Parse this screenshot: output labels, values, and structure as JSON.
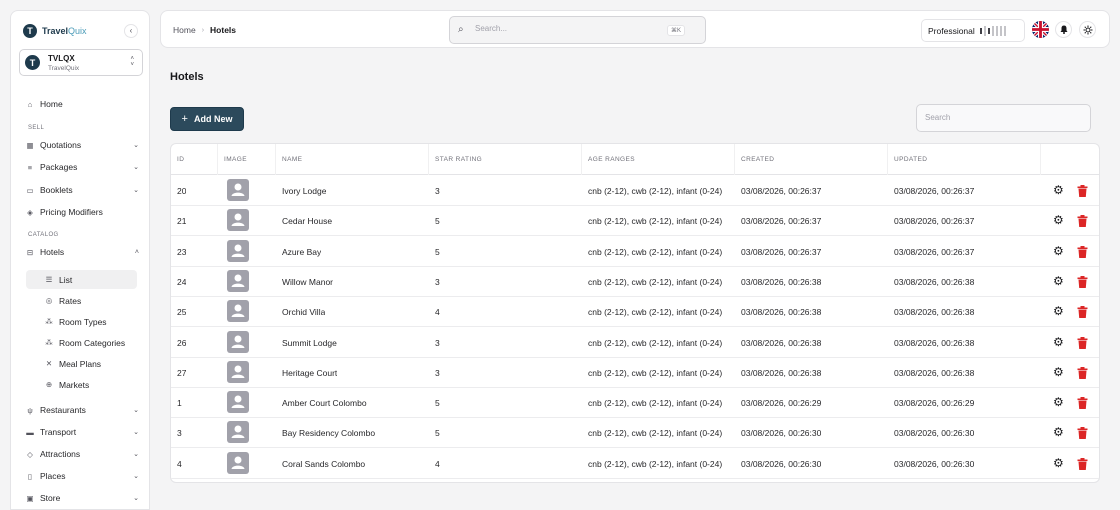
{
  "brand": {
    "name_a": "Travel",
    "name_b": "Quix",
    "logo_letter": "T"
  },
  "org": {
    "name": "TVLQX",
    "sub": "TravelQuix",
    "logo_letter": "T"
  },
  "nav": {
    "home": "Home",
    "section_sell": "SELL",
    "quotations": "Quotations",
    "packages": "Packages",
    "booklets": "Booklets",
    "pricing_modifiers": "Pricing Modifiers",
    "section_catalog": "CATALOG",
    "hotels": "Hotels",
    "hotels_sub": [
      "List",
      "Rates",
      "Room Types",
      "Room Categories",
      "Meal Plans",
      "Markets"
    ],
    "restaurants": "Restaurants",
    "transport": "Transport",
    "attractions": "Attractions",
    "places": "Places",
    "store": "Store"
  },
  "topbar": {
    "crumb_home": "Home",
    "crumb_current": "Hotels",
    "search_placeholder": "Search...",
    "search_kbd": "⌘K",
    "plan": "Professional"
  },
  "page": {
    "title": "Hotels",
    "add_label": "Add New",
    "table_search_placeholder": "Search"
  },
  "table": {
    "headers": [
      "ID",
      "IMAGE",
      "NAME",
      "STAR RATING",
      "AGE RANGES",
      "CREATED",
      "UPDATED"
    ],
    "rows": [
      {
        "id": "20",
        "name": "Ivory Lodge",
        "stars": "3",
        "ages": "cnb (2-12), cwb (2-12), infant (0-24)",
        "created": "03/08/2026, 00:26:37",
        "updated": "03/08/2026, 00:26:37"
      },
      {
        "id": "21",
        "name": "Cedar House",
        "stars": "5",
        "ages": "cnb (2-12), cwb (2-12), infant (0-24)",
        "created": "03/08/2026, 00:26:37",
        "updated": "03/08/2026, 00:26:37"
      },
      {
        "id": "23",
        "name": "Azure Bay",
        "stars": "5",
        "ages": "cnb (2-12), cwb (2-12), infant (0-24)",
        "created": "03/08/2026, 00:26:37",
        "updated": "03/08/2026, 00:26:37"
      },
      {
        "id": "24",
        "name": "Willow Manor",
        "stars": "3",
        "ages": "cnb (2-12), cwb (2-12), infant (0-24)",
        "created": "03/08/2026, 00:26:38",
        "updated": "03/08/2026, 00:26:38"
      },
      {
        "id": "25",
        "name": "Orchid Villa",
        "stars": "4",
        "ages": "cnb (2-12), cwb (2-12), infant (0-24)",
        "created": "03/08/2026, 00:26:38",
        "updated": "03/08/2026, 00:26:38"
      },
      {
        "id": "26",
        "name": "Summit Lodge",
        "stars": "3",
        "ages": "cnb (2-12), cwb (2-12), infant (0-24)",
        "created": "03/08/2026, 00:26:38",
        "updated": "03/08/2026, 00:26:38"
      },
      {
        "id": "27",
        "name": "Heritage Court",
        "stars": "3",
        "ages": "cnb (2-12), cwb (2-12), infant (0-24)",
        "created": "03/08/2026, 00:26:38",
        "updated": "03/08/2026, 00:26:38"
      },
      {
        "id": "1",
        "name": "Amber Court Colombo",
        "stars": "5",
        "ages": "cnb (2-12), cwb (2-12), infant (0-24)",
        "created": "03/08/2026, 00:26:29",
        "updated": "03/08/2026, 00:26:29"
      },
      {
        "id": "3",
        "name": "Bay Residency Colombo",
        "stars": "5",
        "ages": "cnb (2-12), cwb (2-12), infant (0-24)",
        "created": "03/08/2026, 00:26:30",
        "updated": "03/08/2026, 00:26:30"
      },
      {
        "id": "4",
        "name": "Coral Sands Colombo",
        "stars": "4",
        "ages": "cnb (2-12), cwb (2-12), infant (0-24)",
        "created": "03/08/2026, 00:26:30",
        "updated": "03/08/2026, 00:26:30"
      }
    ]
  },
  "colors": {
    "primary": "#2c4a5c",
    "danger": "#dc2626",
    "brand_accent": "#4a9bb8"
  }
}
